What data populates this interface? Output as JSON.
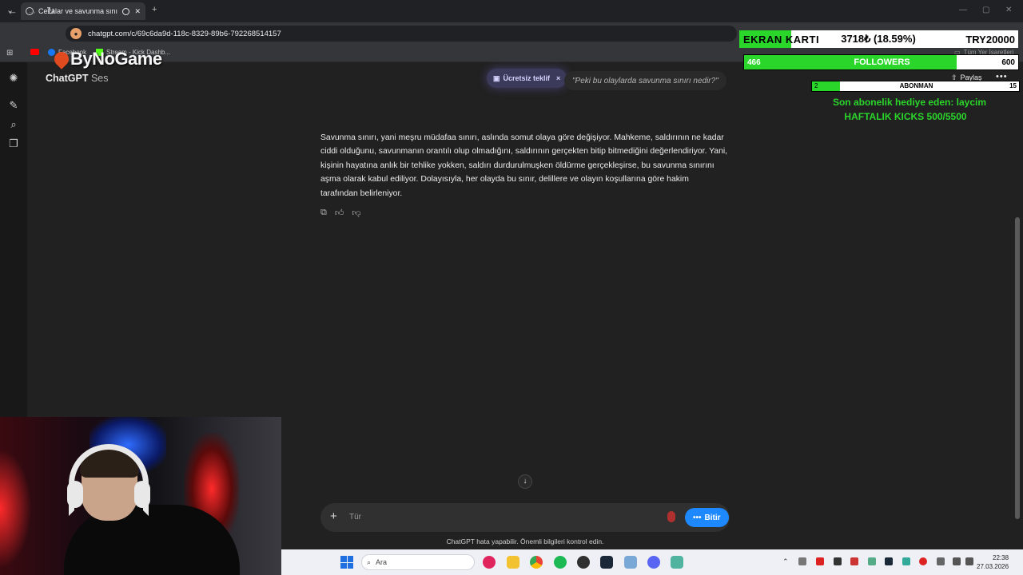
{
  "browser": {
    "tab_title": "Cezalar ve savunma sınırı",
    "url": "chatgpt.com/c/69c6da9d-118c-8329-89b6-792268514157",
    "new_tab": "+",
    "close": "✕",
    "bookmarks": [
      {
        "label": "Facebook",
        "icon": "facebook-icon"
      },
      {
        "label": "Stream - Kick Dashb...",
        "icon": "kick-icon"
      }
    ],
    "bookmarks_right": "Tüm Yer İşaretleri"
  },
  "stream_logo": "ByNoGame",
  "app": {
    "title": "ChatGPT",
    "subtitle": "Ses",
    "offer_label": "Ücretsiz teklif",
    "offer_close": "×",
    "user_quote": "\"Peki bu olaylarda savunma sınırı nedir?\"",
    "share_label": "Paylaş",
    "more": "•••",
    "answer": "Savunma sınırı, yani meşru müdafaa sınırı, aslında somut olaya göre değişiyor. Mahkeme, saldırının ne kadar ciddi olduğunu, savunmanın orantılı olup olmadığını, saldırının gerçekten bitip bitmediğini değerlendiriyor. Yani, kişinin hayatına anlık bir tehlike yokken, saldırı durdurulmuşken öldürme gerçekleşirse, bu savunma sınırını aşma olarak kabul ediliyor. Dolayısıyla, her olayda bu sınır, delillere ve olayın koşullarına göre hakim tarafından belirleniyor.",
    "composer_placeholder": "Tür",
    "end_button": "Bitir",
    "disclaimer": "ChatGPT hata yapabilir. Önemli bilgileri kontrol edin."
  },
  "overlay": {
    "goal_label": "EKRAN KARTI",
    "goal_value": "3718₺ (18.59%)",
    "goal_target": "TRY20000",
    "goal_fraction": 0.1859,
    "followers_current": "466",
    "followers_label": "FOLLOWERS",
    "followers_max": "600",
    "followers_fraction": 0.7767,
    "sub_current": "2",
    "sub_label": "ABONMAN",
    "sub_max": "15",
    "sub_fraction": 0.1333,
    "gift_text": "Son abonelik hediye eden: laycim",
    "kicks_text": "HAFTALIK KICKS 500/5500"
  },
  "taskbar": {
    "search_label": "Ara",
    "time": "22:38",
    "date": "27.03.2026"
  },
  "colors": {
    "accent_blue": "#1e88ff",
    "overlay_green": "#2bd62b",
    "background": "#212121"
  }
}
